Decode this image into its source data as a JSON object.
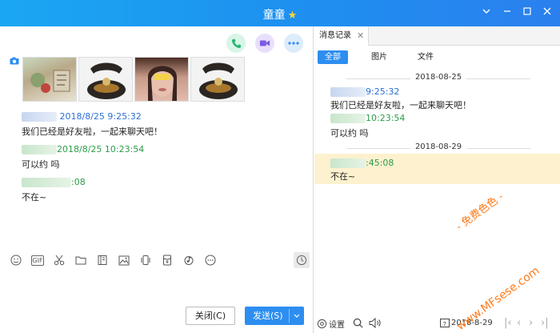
{
  "window": {
    "title": "童童",
    "title_icon": "star-icon"
  },
  "left": {
    "messages": [
      {
        "time": "2018/8/25 9:25:32",
        "text": "我们已经是好友啦，一起来聊天吧！",
        "color": "#2c6fd6"
      },
      {
        "time": "2018/8/25 10:23:54",
        "text": "可以约 吗",
        "color": "#2a9d49"
      },
      {
        "time": ":08",
        "text": "不在~",
        "color": "#2a9d49"
      }
    ],
    "tools": [
      "emoji-icon",
      "gif-icon",
      "scissors-icon",
      "folder-icon",
      "book-icon",
      "image-icon",
      "phone-shake-icon",
      "red-packet-icon",
      "music-icon",
      "more-icon"
    ],
    "gif_label": "GIF",
    "close_label": "关闭(C)",
    "send_label": "发送(S)"
  },
  "right": {
    "tab_label": "消息记录",
    "filters": [
      "全部",
      "图片",
      "文件"
    ],
    "date1": "2018-08-25",
    "date2": "2018-08-29",
    "h1_time": "9:25:32",
    "h1_text": "我们已经是好友啦，一起来聊天吧！",
    "h2_time": "10:23:54",
    "h2_text": "可以约 吗",
    "h3_time": ":45:08",
    "h3_text": "不在~",
    "settings_label": "设置",
    "date_picker": "2018-8-29"
  },
  "watermark": {
    "line1": "- 免费色色 -",
    "line2": "www.MFsese.com"
  }
}
